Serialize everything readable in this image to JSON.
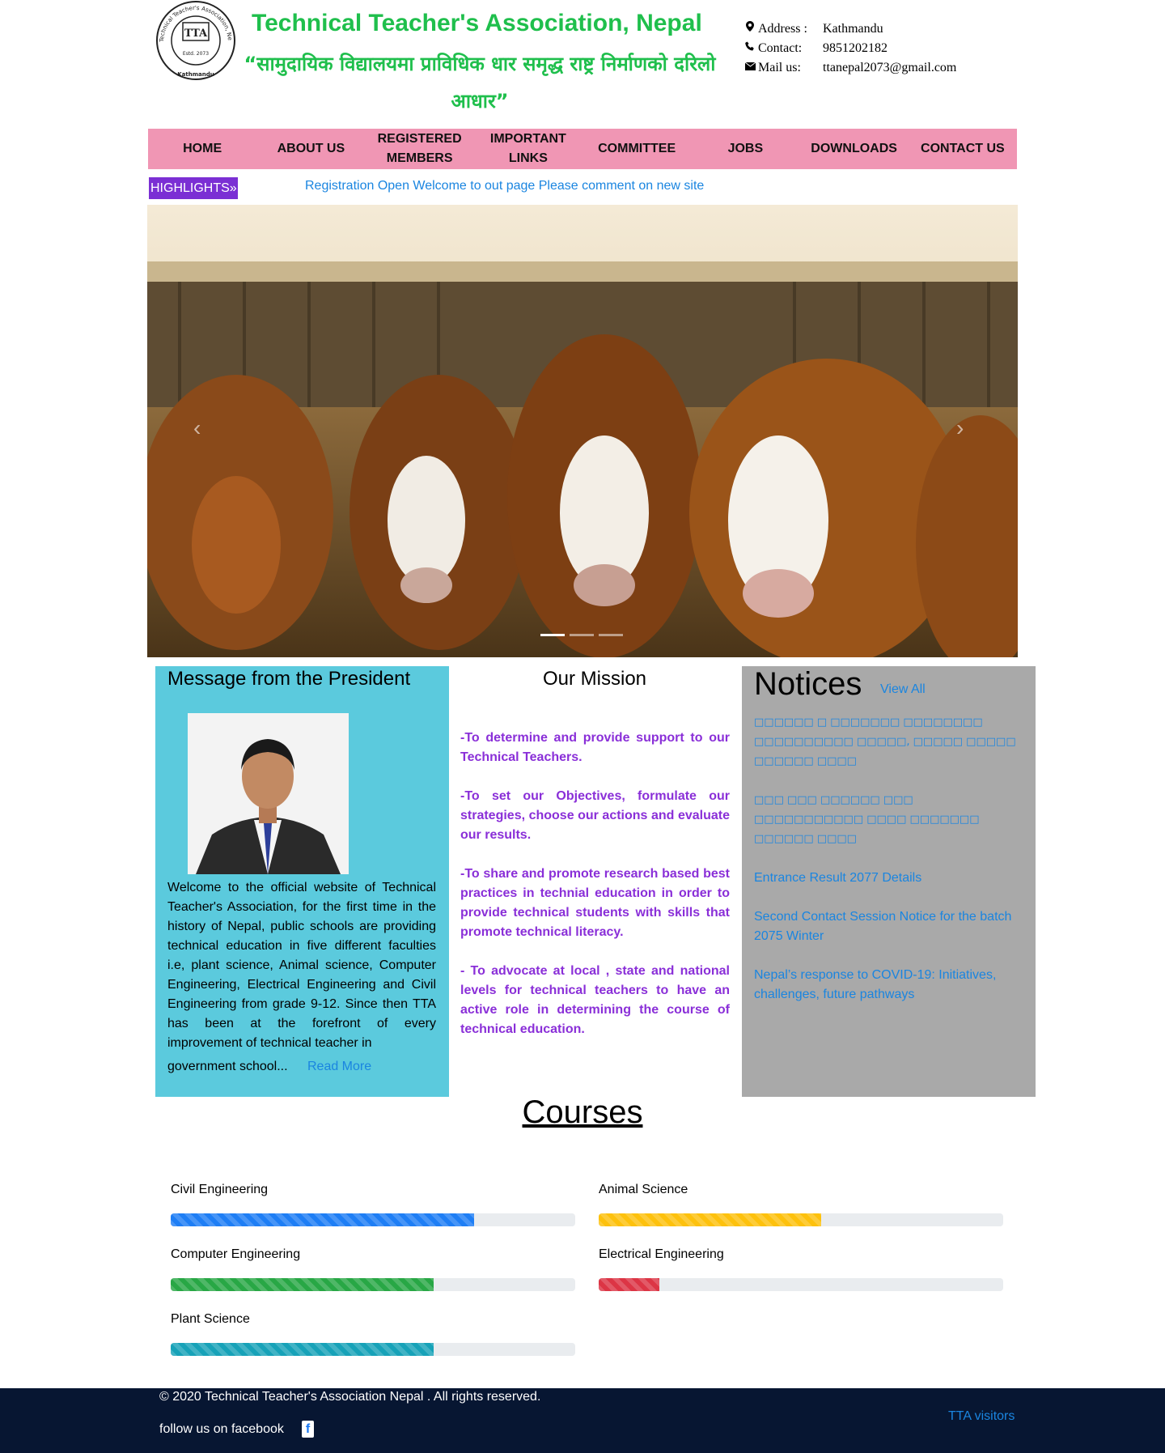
{
  "header": {
    "title": "Technical Teacher's Association, Nepal",
    "slogan": "“सामुदायिक विद्यालयमा प्राविधिक धार समृद्ध राष्ट्र निर्माणको दरिलो आधार”",
    "logo": {
      "ring_text": "Technical Teacher's Association, Nepal",
      "initials": "TTA",
      "estd": "Estd. 2073",
      "city": "Kathmandu"
    },
    "contact": {
      "address_label": "Address :",
      "address_value": "Kathmandu",
      "contact_label": "Contact:",
      "contact_value": "9851202182",
      "mail_label": "Mail us:",
      "mail_value": "ttanepal2073@gmail.com",
      "icons": [
        "map-marker-icon",
        "phone-icon",
        "envelope-icon"
      ]
    }
  },
  "nav": {
    "items": [
      "HOME",
      "ABOUT US",
      "REGISTERED MEMBERS",
      "IMPORTANT LINKS",
      "COMMITTEE",
      "JOBS",
      "DOWNLOADS",
      "CONTACT US"
    ],
    "background": "#f096b4"
  },
  "highlights": {
    "badge": "HIGHLIGHTS»",
    "ticker": "Registration Open Welcome to out page Please comment on new site",
    "badge_color": "#7b2fd4"
  },
  "carousel": {
    "prev": "‹",
    "next": "›",
    "slides": 3,
    "active": 0
  },
  "president": {
    "heading": "Message from the President",
    "text": "Welcome to the official website of Technical Teacher's Association, for the first time in the history of Nepal, public schools are providing technical education in five different faculties i.e, plant science, Animal science, Computer Engineering, Electrical Engineering and Civil Engineering from grade 9-12. Since then TTA has been at the forefront of every improvement of technical teacher in",
    "tail": "government school...",
    "read_more": "Read More",
    "bg": "#5bcadd"
  },
  "mission": {
    "heading": "Our Mission",
    "items": [
      "-To determine and provide support to our Technical Teachers.",
      "-To set our Objectives, formulate our strategies, choose our actions and evaluate our results.",
      "-To share and promote research based best practices in technial education in order to provide technical students with skills that promote technical literacy.",
      "- To advocate at local , state and national levels for technical teachers to have an active role in determining the course of technical education."
    ],
    "color": "#8a2fd8"
  },
  "notices": {
    "heading": "Notices",
    "view_all": "View All",
    "items": [
      "□□□□□□ □ □□□□□□□ □□□□□□□□ □□□□□□□□□□ □□□□□, □□□□□ □□□□□ □□□□□□ □□□□",
      "□□□ □□□ □□□□□□ □□□ □□□□□□□□□□□ □□□□ □□□□□□□ □□□□□□ □□□□",
      "Entrance Result 2077 Details",
      "Second Contact Session Notice for the batch 2075 Winter",
      "Nepal’s response to COVID-19: Initiatives, challenges, future pathways"
    ],
    "bg": "#a9a9a9"
  },
  "courses": {
    "heading": "Courses",
    "items": [
      {
        "name": "Civil Engineering",
        "percent": 75,
        "color": "#1e7ef5"
      },
      {
        "name": "Animal Science",
        "percent": 55,
        "color": "#fdc10d"
      },
      {
        "name": "Computer Engineering",
        "percent": 65,
        "color": "#28a745"
      },
      {
        "name": "Electrical Engineering",
        "percent": 15,
        "color": "#dc3545"
      },
      {
        "name": "Plant Science",
        "percent": 65,
        "color": "#17a2b8"
      }
    ]
  },
  "footer": {
    "copyright": "© 2020 Technical Teacher's Association Nepal . All rights reserved.",
    "follow": "follow us on facebook",
    "facebook_icon": "facebook-icon",
    "visitors": "TTA visitors",
    "bg": "#071632"
  }
}
